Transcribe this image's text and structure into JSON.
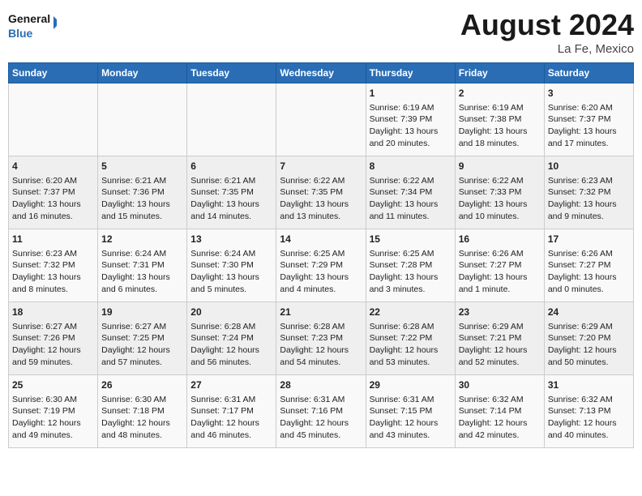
{
  "header": {
    "logo_line1": "General",
    "logo_line2": "Blue",
    "title": "August 2024",
    "subtitle": "La Fe, Mexico"
  },
  "weekdays": [
    "Sunday",
    "Monday",
    "Tuesday",
    "Wednesday",
    "Thursday",
    "Friday",
    "Saturday"
  ],
  "weeks": [
    [
      {
        "day": "",
        "text": ""
      },
      {
        "day": "",
        "text": ""
      },
      {
        "day": "",
        "text": ""
      },
      {
        "day": "",
        "text": ""
      },
      {
        "day": "1",
        "text": "Sunrise: 6:19 AM\nSunset: 7:39 PM\nDaylight: 13 hours and 20 minutes."
      },
      {
        "day": "2",
        "text": "Sunrise: 6:19 AM\nSunset: 7:38 PM\nDaylight: 13 hours and 18 minutes."
      },
      {
        "day": "3",
        "text": "Sunrise: 6:20 AM\nSunset: 7:37 PM\nDaylight: 13 hours and 17 minutes."
      }
    ],
    [
      {
        "day": "4",
        "text": "Sunrise: 6:20 AM\nSunset: 7:37 PM\nDaylight: 13 hours and 16 minutes."
      },
      {
        "day": "5",
        "text": "Sunrise: 6:21 AM\nSunset: 7:36 PM\nDaylight: 13 hours and 15 minutes."
      },
      {
        "day": "6",
        "text": "Sunrise: 6:21 AM\nSunset: 7:35 PM\nDaylight: 13 hours and 14 minutes."
      },
      {
        "day": "7",
        "text": "Sunrise: 6:22 AM\nSunset: 7:35 PM\nDaylight: 13 hours and 13 minutes."
      },
      {
        "day": "8",
        "text": "Sunrise: 6:22 AM\nSunset: 7:34 PM\nDaylight: 13 hours and 11 minutes."
      },
      {
        "day": "9",
        "text": "Sunrise: 6:22 AM\nSunset: 7:33 PM\nDaylight: 13 hours and 10 minutes."
      },
      {
        "day": "10",
        "text": "Sunrise: 6:23 AM\nSunset: 7:32 PM\nDaylight: 13 hours and 9 minutes."
      }
    ],
    [
      {
        "day": "11",
        "text": "Sunrise: 6:23 AM\nSunset: 7:32 PM\nDaylight: 13 hours and 8 minutes."
      },
      {
        "day": "12",
        "text": "Sunrise: 6:24 AM\nSunset: 7:31 PM\nDaylight: 13 hours and 6 minutes."
      },
      {
        "day": "13",
        "text": "Sunrise: 6:24 AM\nSunset: 7:30 PM\nDaylight: 13 hours and 5 minutes."
      },
      {
        "day": "14",
        "text": "Sunrise: 6:25 AM\nSunset: 7:29 PM\nDaylight: 13 hours and 4 minutes."
      },
      {
        "day": "15",
        "text": "Sunrise: 6:25 AM\nSunset: 7:28 PM\nDaylight: 13 hours and 3 minutes."
      },
      {
        "day": "16",
        "text": "Sunrise: 6:26 AM\nSunset: 7:27 PM\nDaylight: 13 hours and 1 minute."
      },
      {
        "day": "17",
        "text": "Sunrise: 6:26 AM\nSunset: 7:27 PM\nDaylight: 13 hours and 0 minutes."
      }
    ],
    [
      {
        "day": "18",
        "text": "Sunrise: 6:27 AM\nSunset: 7:26 PM\nDaylight: 12 hours and 59 minutes."
      },
      {
        "day": "19",
        "text": "Sunrise: 6:27 AM\nSunset: 7:25 PM\nDaylight: 12 hours and 57 minutes."
      },
      {
        "day": "20",
        "text": "Sunrise: 6:28 AM\nSunset: 7:24 PM\nDaylight: 12 hours and 56 minutes."
      },
      {
        "day": "21",
        "text": "Sunrise: 6:28 AM\nSunset: 7:23 PM\nDaylight: 12 hours and 54 minutes."
      },
      {
        "day": "22",
        "text": "Sunrise: 6:28 AM\nSunset: 7:22 PM\nDaylight: 12 hours and 53 minutes."
      },
      {
        "day": "23",
        "text": "Sunrise: 6:29 AM\nSunset: 7:21 PM\nDaylight: 12 hours and 52 minutes."
      },
      {
        "day": "24",
        "text": "Sunrise: 6:29 AM\nSunset: 7:20 PM\nDaylight: 12 hours and 50 minutes."
      }
    ],
    [
      {
        "day": "25",
        "text": "Sunrise: 6:30 AM\nSunset: 7:19 PM\nDaylight: 12 hours and 49 minutes."
      },
      {
        "day": "26",
        "text": "Sunrise: 6:30 AM\nSunset: 7:18 PM\nDaylight: 12 hours and 48 minutes."
      },
      {
        "day": "27",
        "text": "Sunrise: 6:31 AM\nSunset: 7:17 PM\nDaylight: 12 hours and 46 minutes."
      },
      {
        "day": "28",
        "text": "Sunrise: 6:31 AM\nSunset: 7:16 PM\nDaylight: 12 hours and 45 minutes."
      },
      {
        "day": "29",
        "text": "Sunrise: 6:31 AM\nSunset: 7:15 PM\nDaylight: 12 hours and 43 minutes."
      },
      {
        "day": "30",
        "text": "Sunrise: 6:32 AM\nSunset: 7:14 PM\nDaylight: 12 hours and 42 minutes."
      },
      {
        "day": "31",
        "text": "Sunrise: 6:32 AM\nSunset: 7:13 PM\nDaylight: 12 hours and 40 minutes."
      }
    ]
  ]
}
